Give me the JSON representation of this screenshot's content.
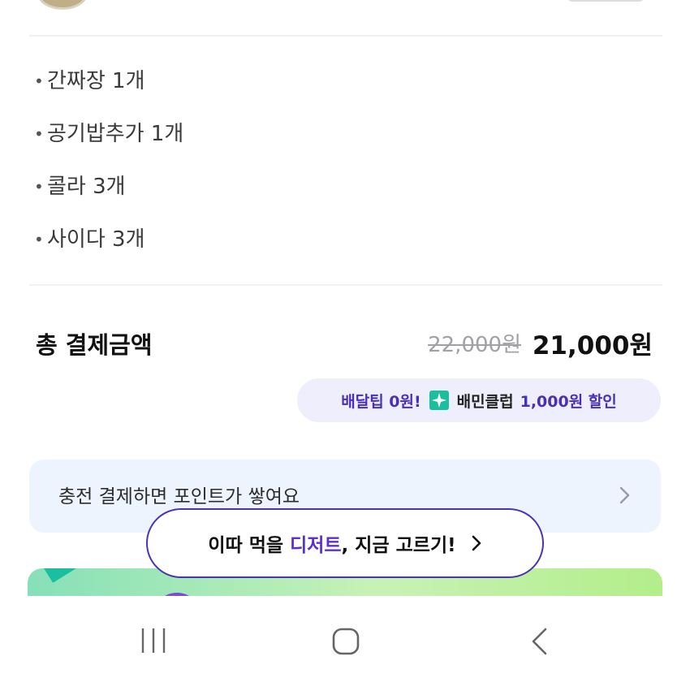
{
  "order_items": [
    {
      "label": "간짜장 1개"
    },
    {
      "label": "공기밥추가 1개"
    },
    {
      "label": "콜라 3개"
    },
    {
      "label": "사이다 3개"
    }
  ],
  "bullet": "•",
  "total": {
    "label": "총 결제금액",
    "original_price": "22,000원",
    "final_price": "21,000원"
  },
  "promo": {
    "tip_text": "배달팁 0원!",
    "club_text": "배민클럽",
    "discount_text": "1,000원 할인",
    "icon": "baemin-club-sparkle-icon",
    "accent_color": "#4a2fb8",
    "icon_color": "#1bbfa0"
  },
  "charge_banner": {
    "text": "충전 결제하면 포인트가 쌓여요",
    "icon": "chevron-right-icon"
  },
  "dessert_prompt": {
    "before": "이따 먹을 ",
    "highlight": "디저트",
    "after": ", 지금 고르기!",
    "highlight_color": "#5b2fd6",
    "border_color": "#4b33b3"
  },
  "nav": {
    "recent_icon": "recent-apps-icon",
    "home_icon": "home-icon",
    "back_icon": "back-icon"
  }
}
